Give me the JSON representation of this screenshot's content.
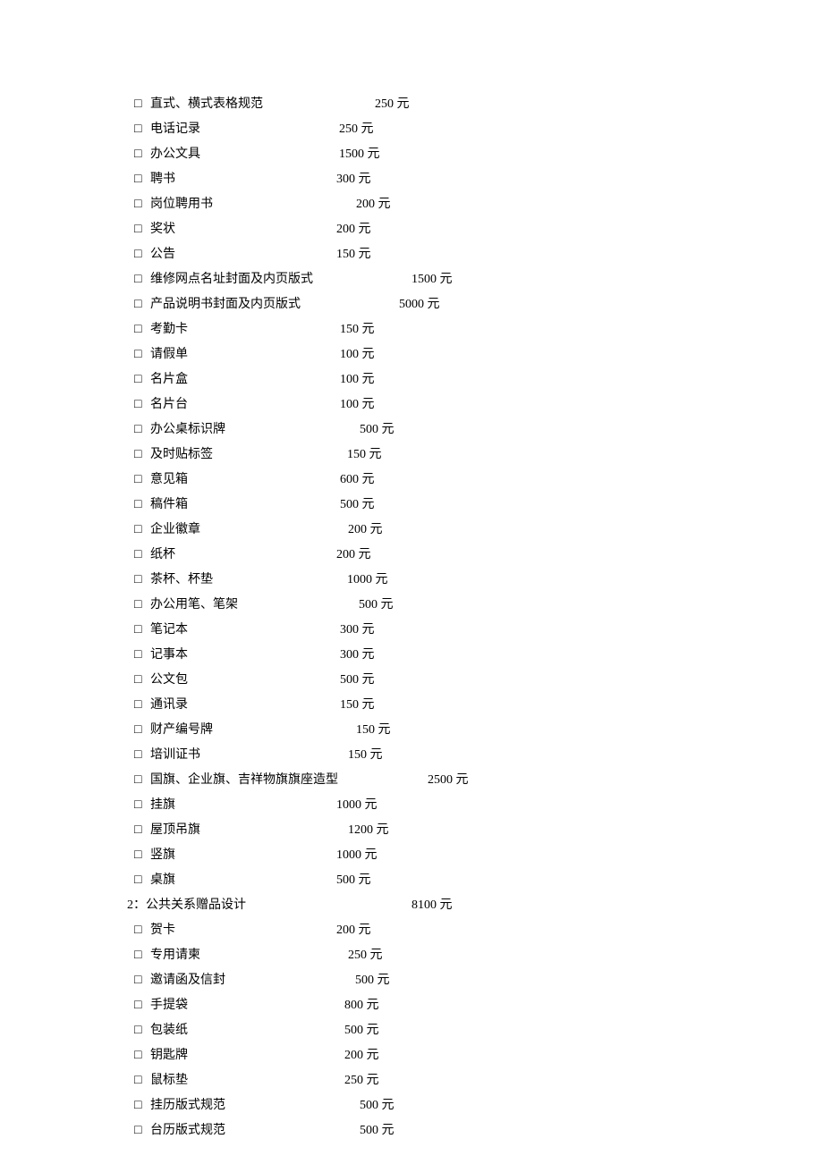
{
  "rows": [
    {
      "kind": "item",
      "label": "直式、横式表格规范",
      "price": "250",
      "gap": 125
    },
    {
      "kind": "item",
      "label": "电话记录",
      "price": "250",
      "gap": 155
    },
    {
      "kind": "item",
      "label": "办公文具",
      "price": "1500",
      "gap": 155
    },
    {
      "kind": "item",
      "label": "聘书",
      "price": "300",
      "gap": 180
    },
    {
      "kind": "item",
      "label": "岗位聘用书",
      "price": "200",
      "gap": 160
    },
    {
      "kind": "item",
      "label": "奖状",
      "price": "200",
      "gap": 180
    },
    {
      "kind": "item",
      "label": "公告",
      "price": "150",
      "gap": 180
    },
    {
      "kind": "item",
      "label": "维修网点名址封面及内页版式",
      "price": "1500",
      "gap": 110
    },
    {
      "kind": "item",
      "label": "产品说明书封面及内页版式",
      "price": "5000",
      "gap": 110
    },
    {
      "kind": "item",
      "label": "考勤卡",
      "price": "150",
      "gap": 170
    },
    {
      "kind": "item",
      "label": "请假单",
      "price": "100",
      "gap": 170
    },
    {
      "kind": "item",
      "label": "名片盒",
      "price": "100",
      "gap": 170
    },
    {
      "kind": "item",
      "label": "名片台",
      "price": "100",
      "gap": 170
    },
    {
      "kind": "item",
      "label": "办公桌标识牌",
      "price": "500",
      "gap": 150
    },
    {
      "kind": "item",
      "label": "及时贴标签",
      "price": "150",
      "gap": 150
    },
    {
      "kind": "item",
      "label": "意见箱",
      "price": "600",
      "gap": 170
    },
    {
      "kind": "item",
      "label": "稿件箱",
      "price": "500",
      "gap": 170
    },
    {
      "kind": "item",
      "label": "企业徽章",
      "price": "200",
      "gap": 165
    },
    {
      "kind": "item",
      "label": "纸杯",
      "price": "200",
      "gap": 180
    },
    {
      "kind": "item",
      "label": "茶杯、杯垫",
      "price": "1000",
      "gap": 150
    },
    {
      "kind": "item",
      "label": "办公用笔、笔架",
      "price": "500",
      "gap": 135
    },
    {
      "kind": "item",
      "label": "笔记本",
      "price": "300",
      "gap": 170
    },
    {
      "kind": "item",
      "label": "记事本",
      "price": "300",
      "gap": 170
    },
    {
      "kind": "item",
      "label": "公文包",
      "price": "500",
      "gap": 170
    },
    {
      "kind": "item",
      "label": "通讯录",
      "price": "150",
      "gap": 170
    },
    {
      "kind": "item",
      "label": "财产编号牌",
      "price": "150",
      "gap": 160
    },
    {
      "kind": "item",
      "label": "培训证书",
      "price": "150",
      "gap": 165
    },
    {
      "kind": "item",
      "label": "国旗、企业旗、吉祥物旗旗座造型",
      "price": "2500",
      "gap": 100
    },
    {
      "kind": "item",
      "label": "挂旗",
      "price": "1000",
      "gap": 180
    },
    {
      "kind": "item",
      "label": "屋顶吊旗",
      "price": "1200",
      "gap": 165
    },
    {
      "kind": "item",
      "label": "竖旗",
      "price": "1000",
      "gap": 180
    },
    {
      "kind": "item",
      "label": "桌旗",
      "price": "500",
      "gap": 180
    },
    {
      "kind": "section",
      "label": "2：公共关系赠品设计",
      "price": "8100",
      "gap": 185
    },
    {
      "kind": "item",
      "label": "贺卡",
      "price": "200",
      "gap": 180
    },
    {
      "kind": "item",
      "label": "专用请柬",
      "price": "250",
      "gap": 165
    },
    {
      "kind": "item",
      "label": "邀请函及信封",
      "price": "500",
      "gap": 145
    },
    {
      "kind": "item",
      "label": "手提袋",
      "price": "800",
      "gap": 175
    },
    {
      "kind": "item",
      "label": "包装纸",
      "price": "500",
      "gap": 175
    },
    {
      "kind": "item",
      "label": "钥匙牌",
      "price": "200",
      "gap": 175
    },
    {
      "kind": "item",
      "label": "鼠标垫",
      "price": "250",
      "gap": 175
    },
    {
      "kind": "item",
      "label": "挂历版式规范",
      "price": "500",
      "gap": 150
    },
    {
      "kind": "item",
      "label": "台历版式规范",
      "price": "500",
      "gap": 150
    }
  ],
  "bullet": "□ ",
  "currency": "元"
}
